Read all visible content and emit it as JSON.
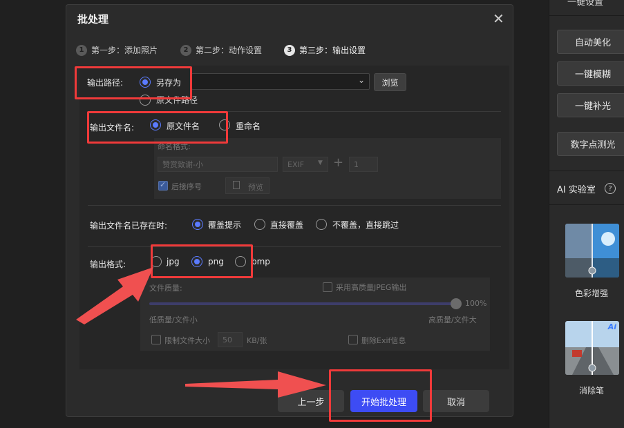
{
  "right_panel": {
    "top_partial_label": "一键设置",
    "buttons": [
      "自动美化",
      "一键模糊",
      "一键补光",
      "数字点测光"
    ],
    "ai_lab_title": "AI 实验室",
    "help_icon": "question-circle-icon",
    "ai_tools": [
      {
        "label": "色彩增强",
        "badge": ""
      },
      {
        "label": "消除笔",
        "badge": "Ai"
      }
    ]
  },
  "dialog": {
    "title": "批处理",
    "close_icon": "close-icon",
    "steps": [
      {
        "num": "1",
        "label": "第一步：添加照片"
      },
      {
        "num": "2",
        "label": "第二步：动作设置"
      },
      {
        "num": "3",
        "label": "第三步：输出设置"
      }
    ],
    "output_path": {
      "label": "输出路径:",
      "option_save_as": "另存为",
      "option_original": "原文件路径",
      "select_value": "",
      "browse_label": "浏览"
    },
    "output_filename": {
      "label": "输出文件名:",
      "option_original": "原文件名",
      "option_rename": "重命名",
      "format_label": "命名格式:",
      "name_placeholder": "赞赏致谢-小",
      "exif_label": "EXIF",
      "plus": "+",
      "seq_value": "1",
      "seq_checkbox": "后接序号",
      "preview_label": "预览"
    },
    "exists": {
      "label": "输出文件名已存在时:",
      "options": [
        "覆盖提示",
        "直接覆盖",
        "不覆盖，直接跳过"
      ]
    },
    "format": {
      "label": "输出格式:",
      "options": [
        "jpg",
        "png",
        "bmp"
      ],
      "quality_label": "文件质量:",
      "hq_jpeg": "采用高质量JPEG输出",
      "quality_percent": "100%",
      "quality_value": 100,
      "low_label": "低质量/文件小",
      "high_label": "高质量/文件大",
      "limit_size": "限制文件大小",
      "limit_value": "50",
      "limit_unit": "KB/张",
      "delete_exif": "删除Exif信息"
    },
    "footer": {
      "prev": "上一步",
      "start": "开始批处理",
      "cancel": "取消"
    }
  },
  "colors": {
    "accent": "#5b7bff",
    "primary_button": "#3d4cf4",
    "annotation": "#f03a3a"
  }
}
